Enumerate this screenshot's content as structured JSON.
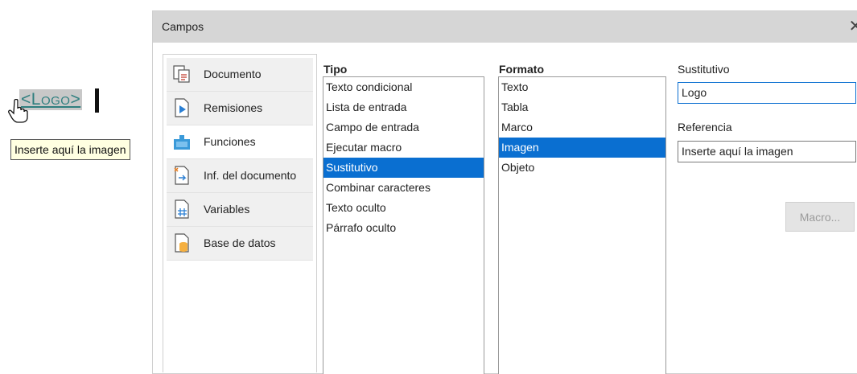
{
  "document": {
    "placeholder_text": "<Logo>",
    "tooltip": "Inserte aquí la imagen"
  },
  "dialog": {
    "title": "Campos",
    "close_glyph": "✕",
    "tabs": [
      {
        "label": "Documento",
        "icon": "document-icon"
      },
      {
        "label": "Remisiones",
        "icon": "cross-reference-icon"
      },
      {
        "label": "Funciones",
        "icon": "functions-icon"
      },
      {
        "label": "Inf. del documento",
        "icon": "document-info-icon"
      },
      {
        "label": "Variables",
        "icon": "variables-icon"
      },
      {
        "label": "Base de datos",
        "icon": "database-icon"
      }
    ],
    "selected_tab": "Funciones",
    "tipo": {
      "header": "Tipo",
      "items": [
        "Texto condicional",
        "Lista de entrada",
        "Campo de entrada",
        "Ejecutar macro",
        "Sustitutivo",
        "Combinar caracteres",
        "Texto oculto",
        "Párrafo oculto"
      ],
      "selected": "Sustitutivo"
    },
    "formato": {
      "header": "Formato",
      "items": [
        "Texto",
        "Tabla",
        "Marco",
        "Imagen",
        "Objeto"
      ],
      "selected": "Imagen"
    },
    "sustitutivo": {
      "label": "Sustitutivo",
      "value": "Logo"
    },
    "referencia": {
      "label": "Referencia",
      "value": "Inserte aquí la imagen"
    },
    "macro_button": "Macro..."
  },
  "colors": {
    "selection": "#0a6fd1",
    "titlebar": "#d6d6d6",
    "tooltip_bg": "#ffffe1",
    "field_shading": "#c8c8c8",
    "field_text": "#2f7f7f"
  }
}
